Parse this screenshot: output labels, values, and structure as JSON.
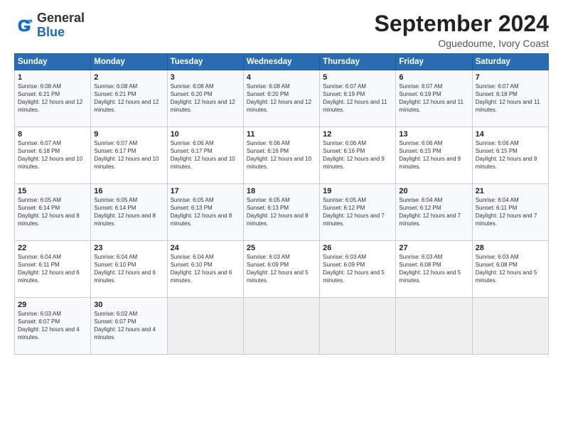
{
  "logo": {
    "general": "General",
    "blue": "Blue"
  },
  "header": {
    "month": "September 2024",
    "location": "Oguedoume, Ivory Coast"
  },
  "days_of_week": [
    "Sunday",
    "Monday",
    "Tuesday",
    "Wednesday",
    "Thursday",
    "Friday",
    "Saturday"
  ],
  "weeks": [
    [
      {
        "day": "1",
        "sunrise": "6:08 AM",
        "sunset": "6:21 PM",
        "daylight": "12 hours and 12 minutes."
      },
      {
        "day": "2",
        "sunrise": "6:08 AM",
        "sunset": "6:21 PM",
        "daylight": "12 hours and 12 minutes."
      },
      {
        "day": "3",
        "sunrise": "6:08 AM",
        "sunset": "6:20 PM",
        "daylight": "12 hours and 12 minutes."
      },
      {
        "day": "4",
        "sunrise": "6:08 AM",
        "sunset": "6:20 PM",
        "daylight": "12 hours and 12 minutes."
      },
      {
        "day": "5",
        "sunrise": "6:07 AM",
        "sunset": "6:19 PM",
        "daylight": "12 hours and 11 minutes."
      },
      {
        "day": "6",
        "sunrise": "6:07 AM",
        "sunset": "6:19 PM",
        "daylight": "12 hours and 11 minutes."
      },
      {
        "day": "7",
        "sunrise": "6:07 AM",
        "sunset": "6:18 PM",
        "daylight": "12 hours and 11 minutes."
      }
    ],
    [
      {
        "day": "8",
        "sunrise": "6:07 AM",
        "sunset": "6:18 PM",
        "daylight": "12 hours and 10 minutes."
      },
      {
        "day": "9",
        "sunrise": "6:07 AM",
        "sunset": "6:17 PM",
        "daylight": "12 hours and 10 minutes."
      },
      {
        "day": "10",
        "sunrise": "6:06 AM",
        "sunset": "6:17 PM",
        "daylight": "12 hours and 10 minutes."
      },
      {
        "day": "11",
        "sunrise": "6:06 AM",
        "sunset": "6:16 PM",
        "daylight": "12 hours and 10 minutes."
      },
      {
        "day": "12",
        "sunrise": "6:06 AM",
        "sunset": "6:16 PM",
        "daylight": "12 hours and 9 minutes."
      },
      {
        "day": "13",
        "sunrise": "6:06 AM",
        "sunset": "6:15 PM",
        "daylight": "12 hours and 9 minutes."
      },
      {
        "day": "14",
        "sunrise": "6:06 AM",
        "sunset": "6:15 PM",
        "daylight": "12 hours and 9 minutes."
      }
    ],
    [
      {
        "day": "15",
        "sunrise": "6:05 AM",
        "sunset": "6:14 PM",
        "daylight": "12 hours and 8 minutes."
      },
      {
        "day": "16",
        "sunrise": "6:05 AM",
        "sunset": "6:14 PM",
        "daylight": "12 hours and 8 minutes."
      },
      {
        "day": "17",
        "sunrise": "6:05 AM",
        "sunset": "6:13 PM",
        "daylight": "12 hours and 8 minutes."
      },
      {
        "day": "18",
        "sunrise": "6:05 AM",
        "sunset": "6:13 PM",
        "daylight": "12 hours and 8 minutes."
      },
      {
        "day": "19",
        "sunrise": "6:05 AM",
        "sunset": "6:12 PM",
        "daylight": "12 hours and 7 minutes."
      },
      {
        "day": "20",
        "sunrise": "6:04 AM",
        "sunset": "6:12 PM",
        "daylight": "12 hours and 7 minutes."
      },
      {
        "day": "21",
        "sunrise": "6:04 AM",
        "sunset": "6:11 PM",
        "daylight": "12 hours and 7 minutes."
      }
    ],
    [
      {
        "day": "22",
        "sunrise": "6:04 AM",
        "sunset": "6:11 PM",
        "daylight": "12 hours and 6 minutes."
      },
      {
        "day": "23",
        "sunrise": "6:04 AM",
        "sunset": "6:10 PM",
        "daylight": "12 hours and 6 minutes."
      },
      {
        "day": "24",
        "sunrise": "6:04 AM",
        "sunset": "6:10 PM",
        "daylight": "12 hours and 6 minutes."
      },
      {
        "day": "25",
        "sunrise": "6:03 AM",
        "sunset": "6:09 PM",
        "daylight": "12 hours and 5 minutes."
      },
      {
        "day": "26",
        "sunrise": "6:03 AM",
        "sunset": "6:09 PM",
        "daylight": "12 hours and 5 minutes."
      },
      {
        "day": "27",
        "sunrise": "6:03 AM",
        "sunset": "6:08 PM",
        "daylight": "12 hours and 5 minutes."
      },
      {
        "day": "28",
        "sunrise": "6:03 AM",
        "sunset": "6:08 PM",
        "daylight": "12 hours and 5 minutes."
      }
    ],
    [
      {
        "day": "29",
        "sunrise": "6:03 AM",
        "sunset": "6:07 PM",
        "daylight": "12 hours and 4 minutes."
      },
      {
        "day": "30",
        "sunrise": "6:02 AM",
        "sunset": "6:07 PM",
        "daylight": "12 hours and 4 minutes."
      },
      null,
      null,
      null,
      null,
      null
    ]
  ]
}
